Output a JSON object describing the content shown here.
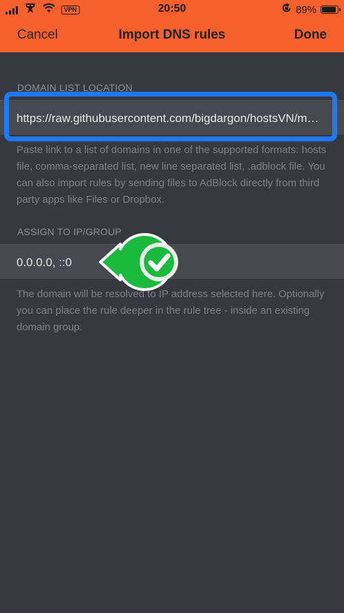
{
  "status_bar": {
    "time": "20:50",
    "vpn_label": "VPN",
    "battery_percent": "89%",
    "battery_level": 0.89,
    "icons": [
      "signal-icon",
      "app-icon",
      "wifi-icon",
      "vpn-icon",
      "orientation-lock-icon",
      "battery-icon"
    ]
  },
  "nav": {
    "cancel_label": "Cancel",
    "title": "Import DNS rules",
    "done_label": "Done"
  },
  "domain_list": {
    "header": "DOMAIN LIST LOCATION",
    "value": "https://raw.githubusercontent.com/bigdargon/hostsVN/master/option/hosts-VN",
    "help": "Paste link to a list of domains in one of the supported formats: hosts file, comma-separated list, new line separated list, .adblock file. You can also import rules by sending files to AdBlock directly from third party apps like Files or Dropbox."
  },
  "assign": {
    "header": "ASSIGN TO IP/GROUP",
    "value": "0.0.0.0, ::0",
    "help": "The domain will be resolved to IP address selected here. Optionally you can place the rule deeper in the rule tree - inside an existing domain group."
  },
  "colors": {
    "accent": "#f5602d",
    "background": "#38393e",
    "highlight": "#1d79f5",
    "check": "#1aba3c"
  }
}
